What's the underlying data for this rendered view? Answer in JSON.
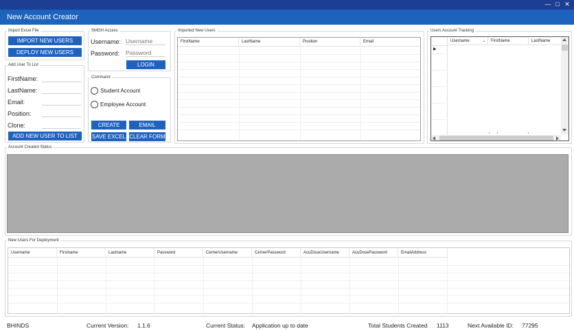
{
  "window": {
    "minimize": "—",
    "maximize": "□",
    "close": "✕"
  },
  "app_title": "New Account Creator",
  "import_group": {
    "legend": "Import Excel File",
    "import_button": "IMPORT NEW USERS",
    "deploy_button": "DEPLOY NEW USERS"
  },
  "add_user_group": {
    "legend": "Add User To List",
    "labels": [
      "FirstName:",
      "LastName:",
      "Email:",
      "Position:",
      "Clone:"
    ],
    "add_button": "ADD NEW USER TO LIST"
  },
  "smgh_group": {
    "legend": "SMGH Access",
    "username_label": "Username:",
    "username_placeholder": "Username",
    "password_label": "Password:",
    "password_placeholder": "Password",
    "login_button": "LOGIN"
  },
  "command_group": {
    "legend": "Command",
    "student_radio": "Student Account",
    "employee_radio": "Employee Account",
    "create_button": "CREATE",
    "email_button": "EMAIL",
    "save_excel_button": "SAVE EXCEL",
    "clear_form_button": "CLEAR FORM"
  },
  "imported_group": {
    "legend": "Imported New Users",
    "columns": [
      "FirstName",
      "LastName",
      "Position",
      "Email"
    ]
  },
  "tracking_group": {
    "legend": "Users Account Tracking",
    "columns": [
      "Username",
      "FirstName",
      "LastName"
    ],
    "sort_indicator": "▲",
    "row_indicator": "▶"
  },
  "status_group": {
    "legend": "Account Created Status"
  },
  "deployment_group": {
    "legend": "New Users For Deployment",
    "columns": [
      "Username",
      "Firstname",
      "Lastname",
      "Password",
      "CernerUsername",
      "CernerPassword",
      "AcuDoseUsername",
      "AcuDosePassword",
      "EmailAddress"
    ]
  },
  "statusbar": {
    "user": "BHINDS",
    "version_label": "Current Version:",
    "version_value": "1.1.6",
    "status_label": "Current Status:",
    "status_value": "Application up to date",
    "students_label": "Total Students Created",
    "students_value": "1113",
    "next_id_label": "Next Available ID:",
    "next_id_value": "77295"
  }
}
